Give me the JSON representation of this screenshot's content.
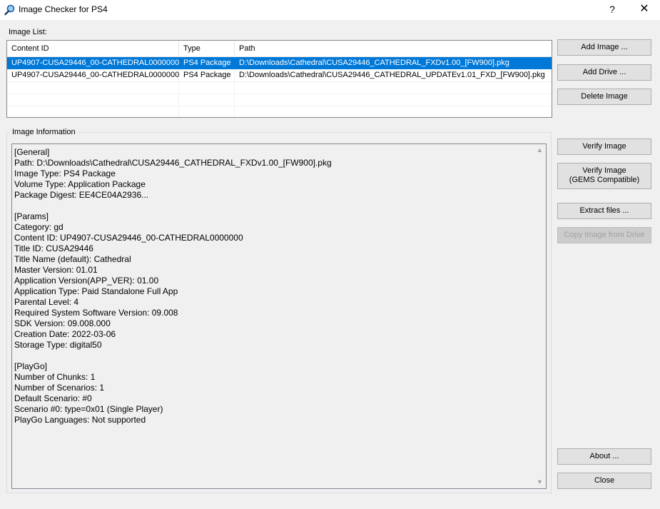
{
  "window": {
    "title": "Image Checker for PS4",
    "help_glyph": "?",
    "close_glyph": "✕",
    "icon": "magnifier-icon"
  },
  "image_list": {
    "label": "Image List:",
    "columns": [
      "Content ID",
      "Type",
      "Path"
    ],
    "rows": [
      {
        "content_id": "UP4907-CUSA29446_00-CATHEDRAL0000000",
        "type": "PS4 Package",
        "path": "D:\\Downloads\\Cathedral\\CUSA29446_CATHEDRAL_FXDv1.00_[FW900].pkg",
        "selected": true
      },
      {
        "content_id": "UP4907-CUSA29446_00-CATHEDRAL0000000",
        "type": "PS4 Package",
        "path": "D:\\Downloads\\Cathedral\\CUSA29446_CATHEDRAL_UPDATEv1.01_FXD_[FW900].pkg",
        "selected": false
      }
    ]
  },
  "image_info": {
    "label": "Image Information",
    "lines": [
      "[General]",
      "Path: D:\\Downloads\\Cathedral\\CUSA29446_CATHEDRAL_FXDv1.00_[FW900].pkg",
      "Image Type: PS4 Package",
      "Volume Type: Application Package",
      "Package Digest: EE4CE04A2936...",
      "",
      "[Params]",
      "Category: gd",
      "Content ID: UP4907-CUSA29446_00-CATHEDRAL0000000",
      "Title ID: CUSA29446",
      "Title Name (default): Cathedral",
      "Master Version: 01.01",
      "Application Version(APP_VER): 01.00",
      "Application Type: Paid Standalone Full App",
      "Parental Level: 4",
      "Required System Software Version: 09.008",
      "SDK Version: 09.008.000",
      "Creation Date: 2022-03-06",
      "Storage Type: digital50",
      "",
      "[PlayGo]",
      "Number of Chunks: 1",
      "Number of Scenarios: 1",
      "Default Scenario: #0",
      "Scenario #0: type=0x01 (Single Player)",
      "PlayGo Languages: Not supported"
    ]
  },
  "buttons": {
    "add_image": "Add Image ...",
    "add_drive": "Add Drive ...",
    "delete_image": "Delete Image",
    "verify_image": "Verify Image",
    "verify_gems_line1": "Verify Image",
    "verify_gems_line2": "(GEMS Compatible)",
    "extract_files": "Extract files ...",
    "copy_from_drive": "Copy Image from Drive",
    "about": "About ...",
    "close": "Close"
  },
  "colors": {
    "selection": "#0078d7",
    "background": "#f0f0f0",
    "button": "#e1e1e1"
  }
}
